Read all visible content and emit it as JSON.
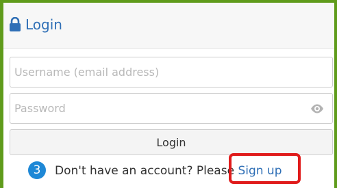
{
  "header": {
    "title": "Login",
    "icon": "lock-icon"
  },
  "form": {
    "username_placeholder": "Username (email address)",
    "password_placeholder": "Password",
    "password_toggle_icon": "eye-icon",
    "login_button_label": "Login"
  },
  "annotation": {
    "step_number": "3",
    "highlight_color": "#e01b1b"
  },
  "signup": {
    "prompt_text": "Don't have an account? Please ",
    "link_text": "Sign up"
  },
  "colors": {
    "frame": "#5f9b1b",
    "accent": "#2f6fb6",
    "badge": "#1e88d6"
  }
}
